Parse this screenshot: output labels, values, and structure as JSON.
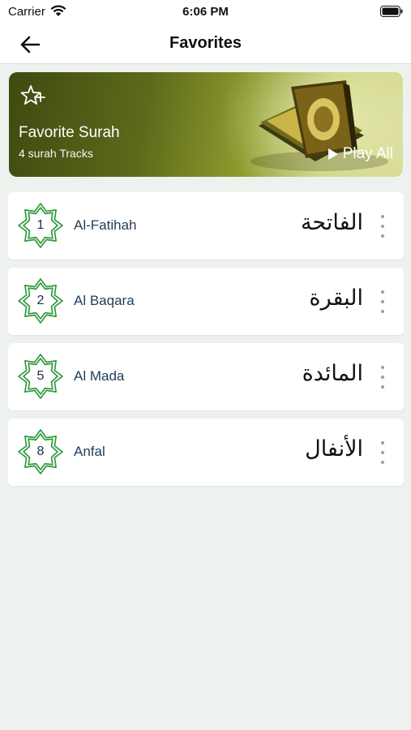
{
  "status_bar": {
    "carrier": "Carrier",
    "time": "6:06 PM"
  },
  "nav": {
    "title": "Favorites"
  },
  "banner": {
    "title": "Favorite Surah",
    "subtitle": "4 surah Tracks",
    "play_all": "Play All"
  },
  "colors": {
    "badge_green": "#2f9a3a",
    "surah_name": "#1f3e5a",
    "background": "#eef2ef"
  },
  "surahs": [
    {
      "number": "1",
      "name": "Al-Fatihah",
      "arabic": "الفاتحة"
    },
    {
      "number": "2",
      "name": "Al Baqara",
      "arabic": "البقرة"
    },
    {
      "number": "5",
      "name": "Al Mada",
      "arabic": "المائدة"
    },
    {
      "number": "8",
      "name": "Anfal",
      "arabic": "الأنفال"
    }
  ]
}
